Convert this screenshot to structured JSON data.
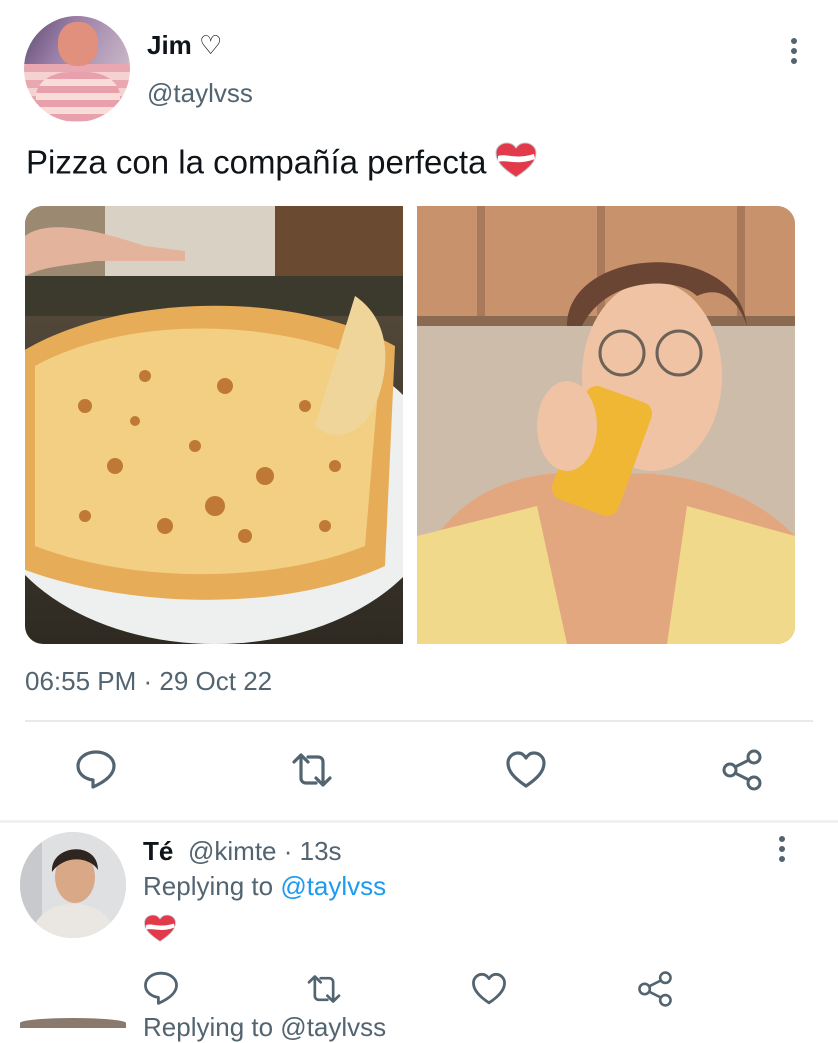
{
  "tweet": {
    "display_name": "Jim ♡",
    "handle": "@taylvss",
    "text": "Pizza con la compañía perfecta",
    "timestamp": "06:55 PM · 29 Oct 22",
    "emoji": "heart-emoji"
  },
  "actions": {
    "reply_icon": "comment-icon",
    "retweet_icon": "retweet-icon",
    "like_icon": "heart-icon",
    "share_icon": "share-icon"
  },
  "reply": {
    "name": "Té",
    "handle_time": "@kimte · 13s",
    "replying_to_prefix": "Replying to ",
    "replying_to_handle": "@taylvss",
    "emoji": "heart-emoji"
  },
  "partial_next": {
    "text": "Replying to @taylvss"
  },
  "colors": {
    "link": "#1d9bf0",
    "secondary_text": "#536471",
    "heart_red": "#e0394a"
  }
}
